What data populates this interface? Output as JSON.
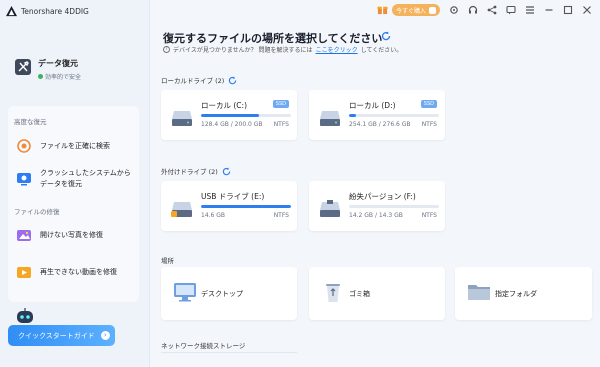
{
  "app": {
    "name": "Tenorshare 4DDIG"
  },
  "topbar": {
    "buy_label": "今すぐ購入"
  },
  "sidebar": {
    "recovery": {
      "title": "データ復元",
      "subtitle": "効率的で安全"
    },
    "section_advanced": "高度な復元",
    "item_precise": "ファイルを正確に検索",
    "item_crash": "クラッシュしたシステムからデータを復元",
    "section_repair": "ファイルの修復",
    "item_photo": "開けない写真を修復",
    "item_video": "再生できない動画を修復",
    "quick_start": "クイックスタートガイド"
  },
  "main": {
    "title": "復元するファイルの場所を選択してください",
    "help_text": "デバイスが見つかりませんか？ 問題を解決するには",
    "help_link": "ここをクリック",
    "help_suffix": "してください。",
    "local_label": "ローカルドライブ (2)",
    "external_label": "外付けドライブ (2)",
    "location_label": "場所",
    "network_label": "ネットワーク接続ストレージ"
  },
  "local_drives": [
    {
      "name": "ローカル (C:)",
      "badge": "SSD",
      "size": "128.4 GB / 200.0 GB",
      "fs": "NTFS",
      "used_fraction": 0.64
    },
    {
      "name": "ローカル (D:)",
      "badge": "SSD",
      "size": "254.1 GB / 276.6 GB",
      "fs": "NTFS",
      "used_fraction": 0.08
    }
  ],
  "external_drives": [
    {
      "name": "USB ドライブ (E:)",
      "size": "14.6 GB",
      "fs": "NTFS",
      "used_fraction": 1.0
    },
    {
      "name": "紛失パージョン (F:)",
      "size": "14.2 GB / 14.3 GB",
      "fs": "NTFS",
      "used_fraction": 0.0
    }
  ],
  "locations": [
    {
      "name": "デスクトップ",
      "icon": "desktop-icon"
    },
    {
      "name": "ゴミ箱",
      "icon": "recycle-bin-icon"
    },
    {
      "name": "指定フォルダ",
      "icon": "folder-icon"
    }
  ],
  "colors": {
    "accent": "#2e7ef2",
    "buy": "#f5b25c",
    "link": "#1a73e8"
  }
}
